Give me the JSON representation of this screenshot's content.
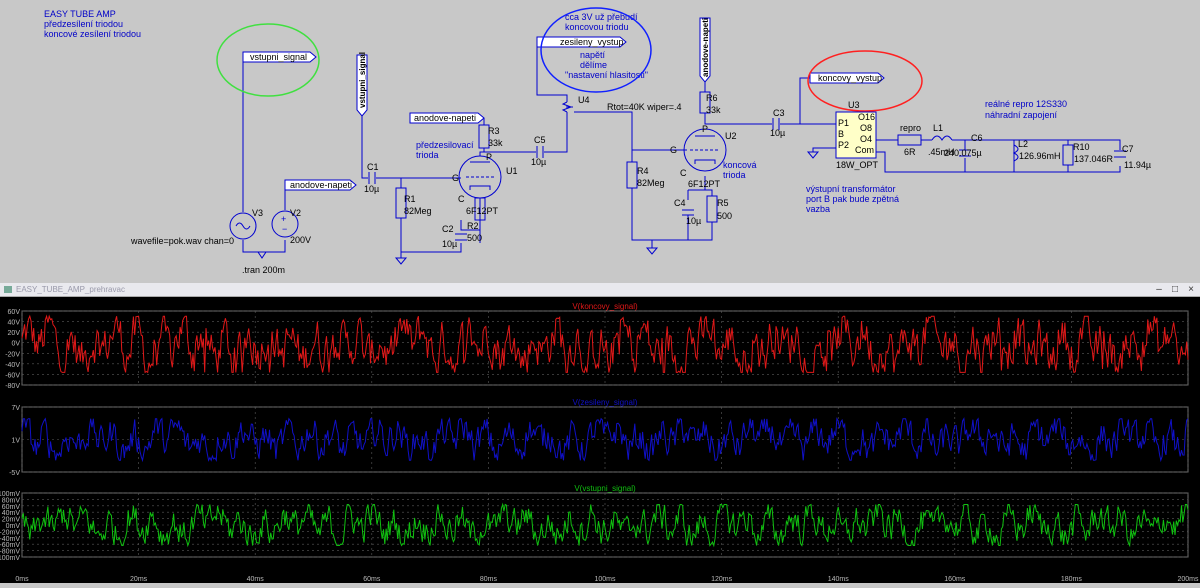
{
  "schematic": {
    "title_lines": [
      "EASY TUBE AMP",
      "předzesílení triodou",
      "koncové zesílení triodou"
    ],
    "net_labels": {
      "vstupni_signal_a": "vstupni_signal",
      "vstupni_signal_b": "vstupni_signal",
      "anodove_napeti_a": "anodove-napeti",
      "anodove_napeti_b": "anodove-napeti",
      "anodove_napeti_c": "anodove-napeti",
      "zesileny_vystup": "zesileny_vystup",
      "koncovy_vystup": "koncovy_vystup"
    },
    "annotations": {
      "u4_note": [
        "cca 3V už přebudí",
        "koncovou triodu"
      ],
      "volume_note": [
        "napětí",
        "dělíme",
        "\"nastavení hlasitosti\""
      ],
      "preamp_label": [
        "předzesilovací",
        "trioda"
      ],
      "final_label": [
        "koncová",
        "trioda"
      ],
      "transformer_note": [
        "výstupní transformátor",
        "port B pak bude zpětná",
        "vazba"
      ],
      "speaker_note": [
        "reálné repro 12S330",
        "náhradní zapojení"
      ],
      "source_params": "wavefile=pok.wav chan=0",
      "tran": ".tran 200m",
      "pot_params": "Rtot=40K wiper=.4"
    },
    "components": {
      "V3": "V3",
      "V2": "V2",
      "V2_value": "200V",
      "C1": "C1",
      "C1_value": "10µ",
      "R1": "R1",
      "R1_value": "82Meg",
      "C2": "C2",
      "C2_value": "10µ",
      "R2": "R2",
      "R2_value": "500",
      "R3": "R3",
      "R3_value": "33k",
      "C5": "C5",
      "C5_value": "10µ",
      "U1": "U1",
      "U1_type": "6F12PT",
      "U4": "U4",
      "R4": "R4",
      "R4_value": "82Meg",
      "R6": "R6",
      "R6_value": "33k",
      "U2": "U2",
      "U2_type": "6F12PT",
      "C4": "C4",
      "C4_value": "10µ",
      "R5": "R5",
      "R5_value": "500",
      "C3": "C3",
      "C3_value": "10µ",
      "U3": "U3",
      "U3_type": "18W_OPT",
      "U3_pins": [
        "P1",
        "B",
        "P2",
        "O16",
        "O8",
        "O4",
        "Com"
      ],
      "repro": "repro",
      "repro_value": "6R",
      "L1": "L1",
      "L1_value": ".45mH",
      "C6": "C6",
      "C6_value": "240.075µ",
      "L2": "L2",
      "L2_value": "126.96mH",
      "R10": "R10",
      "R10_value": "137.046R",
      "C7": "C7",
      "C7_value": "11.94µ",
      "tube_pins": [
        "P",
        "G",
        "C"
      ]
    }
  },
  "waveform_window": {
    "title": "EASY_TUBE_AMP_prehravac",
    "traces": [
      {
        "name": "V(koncovy_signal)",
        "color": "#e01818",
        "ticks": [
          "60V",
          "40V",
          "20V",
          "0V",
          "-20V",
          "-40V",
          "-60V",
          "-80V"
        ]
      },
      {
        "name": "V(zesileny_signal)",
        "color": "#1010c8",
        "ticks": [
          "7V",
          "1V",
          "-5V"
        ]
      },
      {
        "name": "V(vstupni_signal)",
        "color": "#10c010",
        "ticks": [
          "100mV",
          "80mV",
          "60mV",
          "40mV",
          "20mV",
          "0mV",
          "-20mV",
          "-40mV",
          "-60mV",
          "-80mV",
          "-100mV"
        ]
      }
    ],
    "x_ticks": [
      "0ms",
      "20ms",
      "40ms",
      "60ms",
      "80ms",
      "100ms",
      "120ms",
      "140ms",
      "160ms",
      "180ms",
      "200ms"
    ],
    "grid_color": "#5a5a5a"
  }
}
